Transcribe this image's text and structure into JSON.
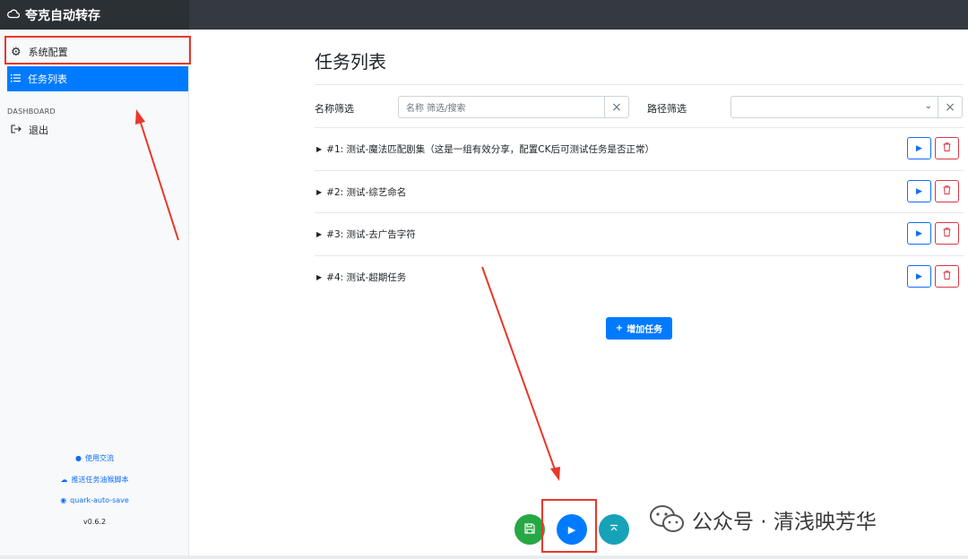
{
  "app": {
    "title": "夸克自动转存"
  },
  "sidebar": {
    "items": [
      {
        "label": "系统配置",
        "icon": "gear-icon"
      },
      {
        "label": "任务列表",
        "icon": "list-icon",
        "active": true
      }
    ],
    "section_label": "DASHBOARD",
    "logout_label": "退出",
    "footer": {
      "links": [
        {
          "label": "使用交流",
          "icon": "wechat-icon"
        },
        {
          "label": "推送任务油猴脚本",
          "icon": "cloud-icon"
        },
        {
          "label": "quark-auto-save",
          "icon": "github-icon"
        }
      ],
      "version": "v0.6.2"
    }
  },
  "main": {
    "title": "任务列表",
    "filters": {
      "name_label": "名称筛选",
      "name_placeholder": "名称 筛选/搜索",
      "path_label": "路径筛选",
      "path_value": ""
    },
    "tasks": [
      {
        "title": "#1: 测试-魔法匹配剧集（这是一组有效分享，配置CK后可测试任务是否正常）"
      },
      {
        "title": "#2: 测试-综艺命名"
      },
      {
        "title": "#3: 测试-去广告字符"
      },
      {
        "title": "#4: 测试-超期任务"
      }
    ],
    "add_button_label": "增加任务"
  },
  "floating_buttons": [
    {
      "name": "save",
      "icon": "save-icon",
      "color": "#28a745"
    },
    {
      "name": "run",
      "icon": "play-icon",
      "color": "#007bff"
    },
    {
      "name": "top",
      "icon": "scroll-top-icon",
      "color": "#17a2b8"
    }
  ],
  "watermark": {
    "text": "公众号 · 清浅映芳华"
  },
  "colors": {
    "accent": "#007bff",
    "danger": "#dc3545",
    "annotation": "#e8382a",
    "topbar": "#343a40"
  }
}
